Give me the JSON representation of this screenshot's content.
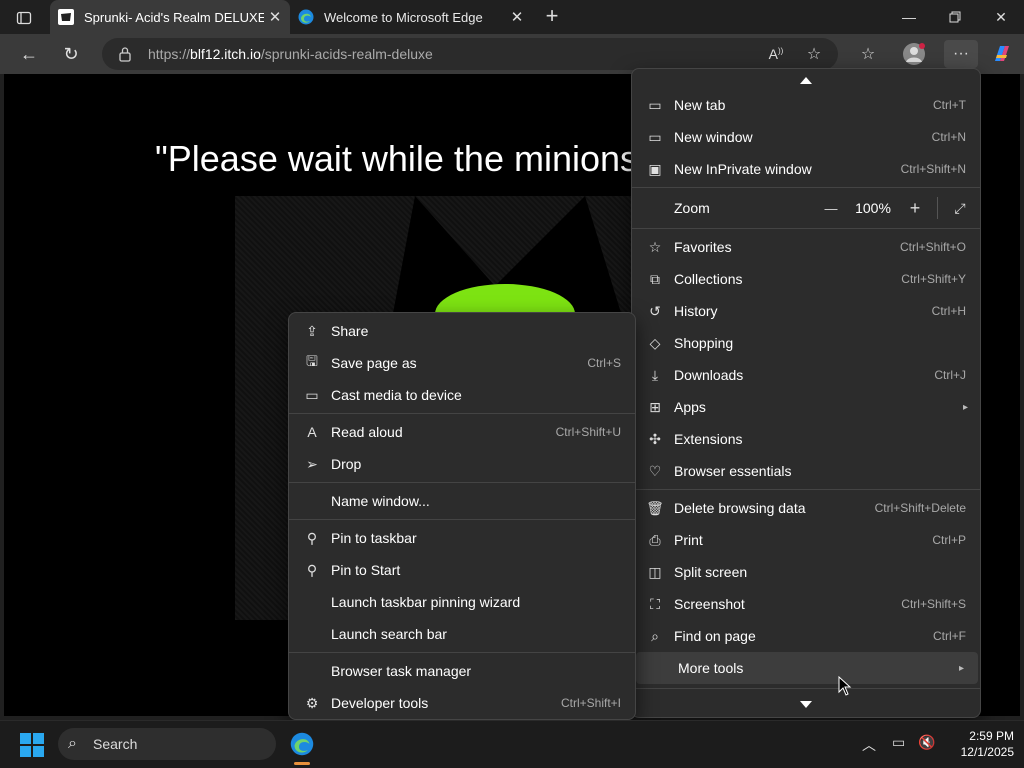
{
  "tabs": [
    {
      "title": "Sprunki- Acid's Realm DELUXE by",
      "favicon": "itch-icon"
    },
    {
      "title": "Welcome to Microsoft Edge",
      "favicon": "edge-icon"
    }
  ],
  "address": {
    "scheme": "https://",
    "host": "blf12.itch.io",
    "path": "/sprunki-acids-realm-deluxe"
  },
  "page": {
    "text": "\"Please wait while the minions"
  },
  "main_menu": {
    "items": [
      {
        "label": "New tab",
        "shortcut": "Ctrl+T",
        "icon": "new-tab-icon"
      },
      {
        "label": "New window",
        "shortcut": "Ctrl+N",
        "icon": "new-window-icon"
      },
      {
        "label": "New InPrivate window",
        "shortcut": "Ctrl+Shift+N",
        "icon": "inprivate-icon"
      },
      {
        "label": "Favorites",
        "shortcut": "Ctrl+Shift+O",
        "icon": "favorites-icon"
      },
      {
        "label": "Collections",
        "shortcut": "Ctrl+Shift+Y",
        "icon": "collections-icon"
      },
      {
        "label": "History",
        "shortcut": "Ctrl+H",
        "icon": "history-icon"
      },
      {
        "label": "Shopping",
        "shortcut": "",
        "icon": "shopping-tag-icon"
      },
      {
        "label": "Downloads",
        "shortcut": "Ctrl+J",
        "icon": "download-icon"
      },
      {
        "label": "Apps",
        "shortcut": "",
        "icon": "apps-icon"
      },
      {
        "label": "Extensions",
        "shortcut": "",
        "icon": "extensions-icon"
      },
      {
        "label": "Browser essentials",
        "shortcut": "",
        "icon": "heart-pulse-icon"
      },
      {
        "label": "Delete browsing data",
        "shortcut": "Ctrl+Shift+Delete",
        "icon": "trash-icon"
      },
      {
        "label": "Print",
        "shortcut": "Ctrl+P",
        "icon": "print-icon"
      },
      {
        "label": "Split screen",
        "shortcut": "",
        "icon": "split-screen-icon"
      },
      {
        "label": "Screenshot",
        "shortcut": "Ctrl+Shift+S",
        "icon": "screenshot-icon"
      },
      {
        "label": "Find on page",
        "shortcut": "Ctrl+F",
        "icon": "find-icon"
      },
      {
        "label": "More tools",
        "shortcut": "",
        "icon": ""
      }
    ],
    "zoom": {
      "label": "Zoom",
      "value": "100%",
      "minus": "—",
      "plus": "+"
    }
  },
  "sub_menu": {
    "items": [
      {
        "label": "Share",
        "shortcut": "",
        "icon": "share-icon"
      },
      {
        "label": "Save page as",
        "shortcut": "Ctrl+S",
        "icon": "save-icon"
      },
      {
        "label": "Cast media to device",
        "shortcut": "",
        "icon": "cast-icon"
      },
      {
        "label": "Read aloud",
        "shortcut": "Ctrl+Shift+U",
        "icon": "read-aloud-icon"
      },
      {
        "label": "Drop",
        "shortcut": "",
        "icon": "drop-icon"
      },
      {
        "label": "Name window...",
        "shortcut": "",
        "icon": ""
      },
      {
        "label": "Pin to taskbar",
        "shortcut": "",
        "icon": "pin-icon"
      },
      {
        "label": "Pin to Start",
        "shortcut": "",
        "icon": "pin-icon"
      },
      {
        "label": "Launch taskbar pinning wizard",
        "shortcut": "",
        "icon": ""
      },
      {
        "label": "Launch search bar",
        "shortcut": "",
        "icon": ""
      },
      {
        "label": "Browser task manager",
        "shortcut": "",
        "icon": ""
      },
      {
        "label": "Developer tools",
        "shortcut": "Ctrl+Shift+I",
        "icon": "devtools-icon"
      }
    ]
  },
  "taskbar": {
    "search_label": "Search",
    "time": "2:59 PM",
    "date": "12/1/2025"
  }
}
